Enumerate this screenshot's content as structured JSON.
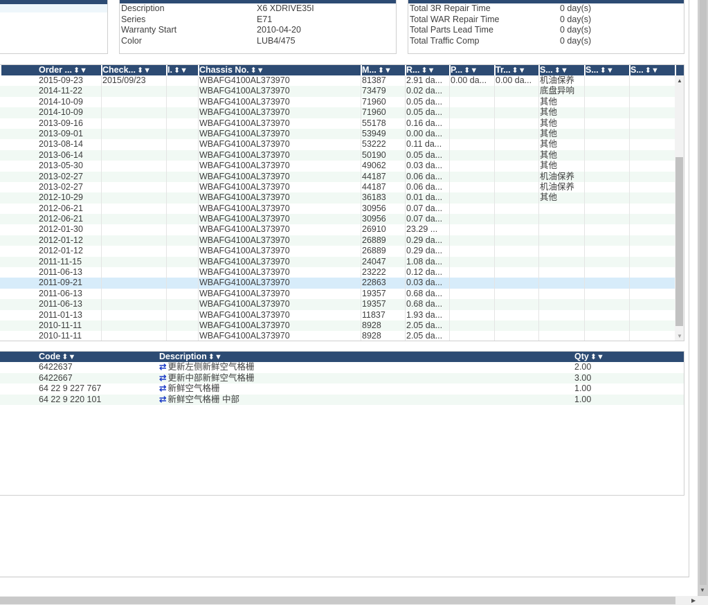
{
  "vehicle_info": [
    {
      "label": "Description",
      "value": "X6 XDRIVE35I"
    },
    {
      "label": "Series",
      "value": "E71"
    },
    {
      "label": "Warranty Start",
      "value": "2010-04-20"
    },
    {
      "label": "Color",
      "value": "LUB4/475"
    }
  ],
  "summary_info": [
    {
      "label": "Total 3R Repair Time",
      "value": "0 day(s)"
    },
    {
      "label": "Total WAR Repair Time",
      "value": "0 day(s)"
    },
    {
      "label": "Total Parts Lead Time",
      "value": "0 day(s)"
    },
    {
      "label": "Total Traffic Comp",
      "value": "0 day(s)"
    }
  ],
  "history_grid": {
    "columns": [
      "Order ...",
      "Check...",
      "I.",
      "Chassis No.",
      "M...",
      "R...",
      "P...",
      "Tr...",
      "S...",
      "S...",
      "S..."
    ],
    "sort_filter_icon": "⬍▼",
    "rows": [
      [
        "2015-09-23",
        "2015/09/23",
        "",
        "WBAFG4100AL373970",
        "81387",
        "2.91 da...",
        "0.00 da...",
        "0.00 da...",
        "机油保养",
        "",
        ""
      ],
      [
        "2014-11-22",
        "",
        "",
        "WBAFG4100AL373970",
        "73479",
        "0.02 da...",
        "",
        "",
        "底盘异响",
        "",
        ""
      ],
      [
        "2014-10-09",
        "",
        "",
        "WBAFG4100AL373970",
        "71960",
        "0.05 da...",
        "",
        "",
        "其他",
        "",
        ""
      ],
      [
        "2014-10-09",
        "",
        "",
        "WBAFG4100AL373970",
        "71960",
        "0.05 da...",
        "",
        "",
        "其他",
        "",
        ""
      ],
      [
        "2013-09-16",
        "",
        "",
        "WBAFG4100AL373970",
        "55178",
        "0.16 da...",
        "",
        "",
        "其他",
        "",
        ""
      ],
      [
        "2013-09-01",
        "",
        "",
        "WBAFG4100AL373970",
        "53949",
        "0.00 da...",
        "",
        "",
        "其他",
        "",
        ""
      ],
      [
        "2013-08-14",
        "",
        "",
        "WBAFG4100AL373970",
        "53222",
        "0.11 da...",
        "",
        "",
        "其他",
        "",
        ""
      ],
      [
        "2013-06-14",
        "",
        "",
        "WBAFG4100AL373970",
        "50190",
        "0.05 da...",
        "",
        "",
        "其他",
        "",
        ""
      ],
      [
        "2013-05-30",
        "",
        "",
        "WBAFG4100AL373970",
        "49062",
        "0.03 da...",
        "",
        "",
        "其他",
        "",
        ""
      ],
      [
        "2013-02-27",
        "",
        "",
        "WBAFG4100AL373970",
        "44187",
        "0.06 da...",
        "",
        "",
        "机油保养",
        "",
        ""
      ],
      [
        "2013-02-27",
        "",
        "",
        "WBAFG4100AL373970",
        "44187",
        "0.06 da...",
        "",
        "",
        "机油保养",
        "",
        ""
      ],
      [
        "2012-10-29",
        "",
        "",
        "WBAFG4100AL373970",
        "36183",
        "0.01 da...",
        "",
        "",
        "其他",
        "",
        ""
      ],
      [
        "2012-06-21",
        "",
        "",
        "WBAFG4100AL373970",
        "30956",
        "0.07 da...",
        "",
        "",
        "",
        "",
        ""
      ],
      [
        "2012-06-21",
        "",
        "",
        "WBAFG4100AL373970",
        "30956",
        "0.07 da...",
        "",
        "",
        "",
        "",
        ""
      ],
      [
        "2012-01-30",
        "",
        "",
        "WBAFG4100AL373970",
        "26910",
        "23.29 ...",
        "",
        "",
        "",
        "",
        ""
      ],
      [
        "2012-01-12",
        "",
        "",
        "WBAFG4100AL373970",
        "26889",
        "0.29 da...",
        "",
        "",
        "",
        "",
        ""
      ],
      [
        "2012-01-12",
        "",
        "",
        "WBAFG4100AL373970",
        "26889",
        "0.29 da...",
        "",
        "",
        "",
        "",
        ""
      ],
      [
        "2011-11-15",
        "",
        "",
        "WBAFG4100AL373970",
        "24047",
        "1.08 da...",
        "",
        "",
        "",
        "",
        ""
      ],
      [
        "2011-06-13",
        "",
        "",
        "WBAFG4100AL373970",
        "23222",
        "0.12 da...",
        "",
        "",
        "",
        "",
        ""
      ],
      [
        "2011-09-21",
        "",
        "",
        "WBAFG4100AL373970",
        "22863",
        "0.03 da...",
        "",
        "",
        "",
        "",
        ""
      ],
      [
        "2011-06-13",
        "",
        "",
        "WBAFG4100AL373970",
        "19357",
        "0.68 da...",
        "",
        "",
        "",
        "",
        ""
      ],
      [
        "2011-06-13",
        "",
        "",
        "WBAFG4100AL373970",
        "19357",
        "0.68 da...",
        "",
        "",
        "",
        "",
        ""
      ],
      [
        "2011-01-13",
        "",
        "",
        "WBAFG4100AL373970",
        "11837",
        "1.93 da...",
        "",
        "",
        "",
        "",
        ""
      ],
      [
        "2010-11-11",
        "",
        "",
        "WBAFG4100AL373970",
        "8928",
        "2.05 da...",
        "",
        "",
        "",
        "",
        ""
      ],
      [
        "2010-11-11",
        "",
        "",
        "WBAFG4100AL373970",
        "8928",
        "2.05 da...",
        "",
        "",
        "",
        "",
        ""
      ]
    ],
    "selected_row": 19
  },
  "parts_grid": {
    "columns": [
      "Code",
      "Description",
      "Qty"
    ],
    "swap_icon": "⇄",
    "rows": [
      [
        "6422637",
        "更新左侧新鲜空气格栅",
        "2.00"
      ],
      [
        "6422667",
        "更新中部新鲜空气格栅",
        "3.00"
      ],
      [
        "64 22 9 227 767",
        "新鲜空气格栅",
        "1.00"
      ],
      [
        "64 22 9 220 101",
        "新鲜空气格栅 中部",
        "1.00"
      ]
    ]
  },
  "colors": {
    "header_bg": "#2d4b73",
    "row_alt": "#f1f9f4",
    "row_selected": "#d7ecfa",
    "swap_icon": "#2040c8"
  }
}
